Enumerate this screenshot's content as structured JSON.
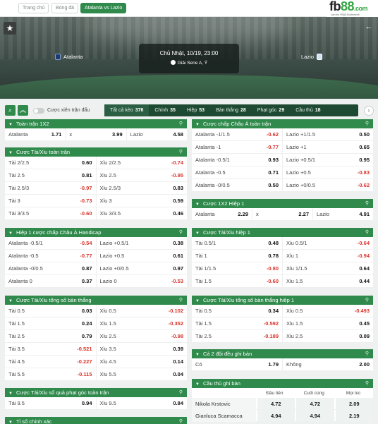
{
  "breadcrumb": [
    "Trang chủ",
    "Bóng đá",
    "Atalanta vs Lazio"
  ],
  "logo": {
    "brand_a": "fb",
    "brand_b": "88",
    "brand_c": ".com",
    "tagline": "Join the FB88 Excitement!"
  },
  "match": {
    "datetime": "Chủ Nhật, 10/19, 23:00",
    "league": "Giải Serie A, Ý",
    "home": "Atalanta",
    "away": "Lazio"
  },
  "filter": {
    "combo_label": "Cược xiên trận đấu"
  },
  "tabs": [
    {
      "label": "Tất cả kèo",
      "count": "376"
    },
    {
      "label": "Chính",
      "count": "35"
    },
    {
      "label": "Hiệp",
      "count": "53"
    },
    {
      "label": "Bàn thắng",
      "count": "28"
    },
    {
      "label": "Phạt góc",
      "count": "29"
    },
    {
      "label": "Cầu thủ",
      "count": "18"
    }
  ],
  "panels": {
    "p1x2": {
      "title": "Toàn trận 1X2",
      "rows": [
        [
          [
            "Atalanta",
            "1.71",
            ""
          ],
          [
            "x",
            "3.99",
            ""
          ],
          [
            "Lazio",
            "4.58",
            ""
          ]
        ]
      ]
    },
    "pou": {
      "title": "Cược Tài/Xỉu toàn trận",
      "rows": [
        [
          [
            "Tài 2/2.5",
            "0.60",
            ""
          ],
          [
            "Xỉu 2/2.5",
            "-0.74",
            "neg"
          ]
        ],
        [
          [
            "Tài 2.5",
            "0.81",
            ""
          ],
          [
            "Xỉu 2.5",
            "-0.95",
            "neg"
          ]
        ],
        [
          [
            "Tài 2.5/3",
            "-0.97",
            "neg"
          ],
          [
            "Xỉu 2.5/3",
            "0.83",
            ""
          ]
        ],
        [
          [
            "Tài 3",
            "-0.73",
            "neg"
          ],
          [
            "Xỉu 3",
            "0.59",
            ""
          ]
        ],
        [
          [
            "Tài 3/3.5",
            "-0.60",
            "neg"
          ],
          [
            "Xỉu 3/3.5",
            "0.46",
            ""
          ]
        ]
      ]
    },
    "pah1": {
      "title": "Hiệp 1 cược chấp Châu Á Handicap",
      "rows": [
        [
          [
            "Atalanta -0.5/1",
            "-0.54",
            "neg"
          ],
          [
            "Lazio +0.5/1",
            "0.38",
            ""
          ]
        ],
        [
          [
            "Atalanta -0.5",
            "-0.77",
            "neg"
          ],
          [
            "Lazio +0.5",
            "0.61",
            ""
          ]
        ],
        [
          [
            "Atalanta -0/0.5",
            "0.87",
            ""
          ],
          [
            "Lazio +0/0.5",
            "0.97",
            ""
          ]
        ],
        [
          [
            "Atalanta 0",
            "0.37",
            ""
          ],
          [
            "Lazio 0",
            "-0.53",
            "neg"
          ]
        ]
      ]
    },
    "ptg": {
      "title": "Cược Tài/Xỉu tổng số bàn thắng",
      "rows": [
        [
          [
            "Tài 0.5",
            "0.03",
            ""
          ],
          [
            "Xỉu 0.5",
            "-0.102",
            "neg"
          ]
        ],
        [
          [
            "Tài 1.5",
            "0.24",
            ""
          ],
          [
            "Xỉu 1.5",
            "-0.352",
            "neg"
          ]
        ],
        [
          [
            "Tài 2.5",
            "0.79",
            ""
          ],
          [
            "Xỉu 2.5",
            "-0.98",
            "neg"
          ]
        ],
        [
          [
            "Tài 3.5",
            "-0.521",
            "neg"
          ],
          [
            "Xỉu 3.5",
            "0.39",
            ""
          ]
        ],
        [
          [
            "Tài 4.5",
            "-0.227",
            "neg"
          ],
          [
            "Xỉu 4.5",
            "0.14",
            ""
          ]
        ],
        [
          [
            "Tài 5.5",
            "-0.115",
            "neg"
          ],
          [
            "Xỉu 5.5",
            "0.04",
            ""
          ]
        ]
      ]
    },
    "pcorner": {
      "title": "Cược Tài/Xỉu số quả phạt góc toàn trận",
      "rows": [
        [
          [
            "Tài 9.5",
            "0.94",
            ""
          ],
          [
            "Xỉu 9.5",
            "0.84",
            ""
          ]
        ]
      ]
    },
    "pnext": {
      "title": "Tỉ số chính xác"
    },
    "pah": {
      "title": "Cược chấp Châu Á toàn trận",
      "rows": [
        [
          [
            "Atalanta -1/1.5",
            "-0.62",
            "neg"
          ],
          [
            "Lazio +1/1.5",
            "0.50",
            ""
          ]
        ],
        [
          [
            "Atalanta -1",
            "-0.77",
            "neg"
          ],
          [
            "Lazio +1",
            "0.65",
            ""
          ]
        ],
        [
          [
            "Atalanta -0.5/1",
            "0.93",
            ""
          ],
          [
            "Lazio +0.5/1",
            "0.95",
            ""
          ]
        ],
        [
          [
            "Atalanta -0.5",
            "0.71",
            ""
          ],
          [
            "Lazio +0.5",
            "-0.83",
            "neg"
          ]
        ],
        [
          [
            "Atalanta -0/0.5",
            "0.50",
            ""
          ],
          [
            "Lazio +0/0.5",
            "-0.62",
            "neg"
          ]
        ]
      ]
    },
    "p1x2h1": {
      "title": "Cược 1X2 Hiệp 1",
      "rows": [
        [
          [
            "Atalanta",
            "2.29",
            ""
          ],
          [
            "x",
            "2.27",
            ""
          ],
          [
            "Lazio",
            "4.91",
            ""
          ]
        ]
      ]
    },
    "pouh1": {
      "title": "Cược Tài/Xỉu hiệp 1",
      "rows": [
        [
          [
            "Tài 0.5/1",
            "0.48",
            ""
          ],
          [
            "Xỉu 0.5/1",
            "-0.64",
            "neg"
          ]
        ],
        [
          [
            "Tài 1",
            "0.78",
            ""
          ],
          [
            "Xỉu 1",
            "-0.94",
            "neg"
          ]
        ],
        [
          [
            "Tài 1/1.5",
            "-0.80",
            "neg"
          ],
          [
            "Xỉu 1/1.5",
            "0.64",
            ""
          ]
        ],
        [
          [
            "Tài 1.5",
            "-0.60",
            "neg"
          ],
          [
            "Xỉu 1.5",
            "0.44",
            ""
          ]
        ]
      ]
    },
    "ptgh1": {
      "title": "Cược Tài/Xỉu tổng số bàn thắng hiệp 1",
      "rows": [
        [
          [
            "Tài 0.5",
            "0.34",
            ""
          ],
          [
            "Xỉu 0.5",
            "-0.493",
            "neg"
          ]
        ],
        [
          [
            "Tài 1.5",
            "-0.592",
            "neg"
          ],
          [
            "Xỉu 1.5",
            "0.45",
            ""
          ]
        ],
        [
          [
            "Tài 2.5",
            "-0.189",
            "neg"
          ],
          [
            "Xỉu 2.5",
            "0.09",
            ""
          ]
        ]
      ]
    },
    "pbtts": {
      "title": "Cả 2 đội đều ghi bàn",
      "rows": [
        [
          [
            "Có",
            "1.79",
            ""
          ],
          [
            "Không",
            "2.00",
            ""
          ]
        ]
      ]
    },
    "pscorer": {
      "title": "Cầu thủ ghi bàn",
      "headers": [
        "Đầu tiên",
        "Cuối cùng",
        "Mọi lúc"
      ],
      "rows": [
        [
          "Nikola Krstovic",
          "4.72",
          "4.72",
          "2.09"
        ],
        [
          "Gianluca Scamacca",
          "4.94",
          "4.94",
          "2.19"
        ]
      ]
    }
  }
}
